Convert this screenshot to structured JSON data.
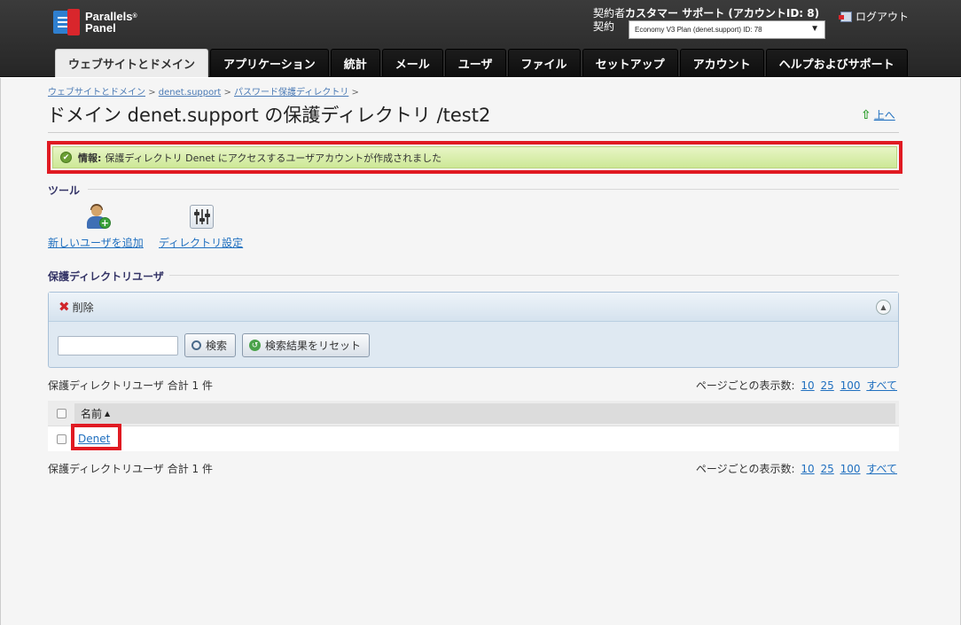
{
  "header": {
    "logo_line1": "Parallels",
    "logo_reg": "®",
    "logo_line2": "Panel",
    "account_label": "契約者",
    "account_name": "カスタマー サポート (アカウントID: 8)",
    "subscription_label": "契約",
    "subscription_value": "Economy V3 Plan (denet.support) ID: 78",
    "logout_label": "ログアウト"
  },
  "tabs": [
    {
      "label": "ウェブサイトとドメイン",
      "active": true
    },
    {
      "label": "アプリケーション"
    },
    {
      "label": "統計"
    },
    {
      "label": "メール"
    },
    {
      "label": "ユーザ"
    },
    {
      "label": "ファイル"
    },
    {
      "label": "セットアップ"
    },
    {
      "label": "アカウント"
    },
    {
      "label": "ヘルプおよびサポート"
    }
  ],
  "breadcrumb": [
    "ウェブサイトとドメイン",
    "denet.support",
    "パスワード保護ディレクトリ"
  ],
  "breadcrumb_separator": ">",
  "page_title": "ドメイン denet.support の保護ディレクトリ /test2",
  "up_link": "上へ",
  "info": {
    "label": "情報:",
    "message": "保護ディレクトリ Denet にアクセスするユーザアカウントが作成されました"
  },
  "tools": {
    "section_title": "ツール",
    "add_user": "新しいユーザを追加",
    "dir_settings": "ディレクトリ設定"
  },
  "users": {
    "section_title": "保護ディレクトリユーザ",
    "delete_label": "削除",
    "search_value": "",
    "search_button": "検索",
    "reset_button": "検索結果をリセット",
    "total_text": "保護ディレクトリユーザ 合計 1 件",
    "per_page_label": "ページごとの表示数:",
    "per_page_options": [
      "10",
      "25",
      "100",
      "すべて"
    ],
    "column_name": "名前",
    "rows": [
      {
        "name": "Denet"
      }
    ]
  },
  "colors": {
    "header_bg": "#2e2e2e",
    "highlight_red": "#e01a22",
    "info_green": "#d5ecaa",
    "link_blue": "#1f6fbf"
  }
}
